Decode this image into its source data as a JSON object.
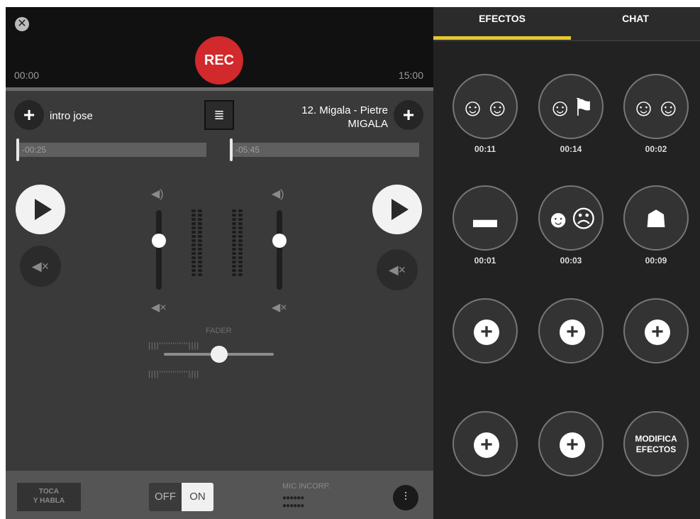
{
  "recorder": {
    "close_icon": "close-icon",
    "rec_label": "REC",
    "time_start": "00:00",
    "time_end": "15:00"
  },
  "deck": {
    "left_track": "intro jose",
    "right_track_line1": "12. Migala - Pietre",
    "right_track_line2": "MIGALA",
    "left_remaining": "-00:25",
    "right_remaining": "-05:45",
    "left_progress": 0.0,
    "right_progress": 0.0,
    "left_volume": 0.6,
    "right_volume": 0.6,
    "fader_label": "FADER",
    "fader_position": 0.5
  },
  "bottom": {
    "talk_line1": "TOCA",
    "talk_line2": "Y HABLA",
    "toggle_off": "OFF",
    "toggle_on": "ON",
    "toggle_state": "ON",
    "mic_label": "MIC INCORP."
  },
  "tabs": {
    "effects": "EFECTOS",
    "chat": "CHAT",
    "active": "EFECTOS"
  },
  "effects": [
    {
      "icon": "applause-icon",
      "glyph": "☺☺",
      "time": "00:11"
    },
    {
      "icon": "cheer-flag-icon",
      "glyph": "☺⚑",
      "time": "00:14"
    },
    {
      "icon": "laughter-icon",
      "glyph": "☺☺",
      "time": "00:02"
    },
    {
      "icon": "gun-icon",
      "glyph": "▬",
      "time": "00:01"
    },
    {
      "icon": "theater-masks-icon",
      "glyph": "☻☹",
      "time": "00:03"
    },
    {
      "icon": "spy-icon",
      "glyph": "☗",
      "time": "00:09"
    }
  ],
  "empty_slots": 5,
  "modify_line1": "MODIFICA",
  "modify_line2": "EFECTOS",
  "colors": {
    "rec": "#d1292c",
    "tab_indicator": "#e5c832"
  }
}
